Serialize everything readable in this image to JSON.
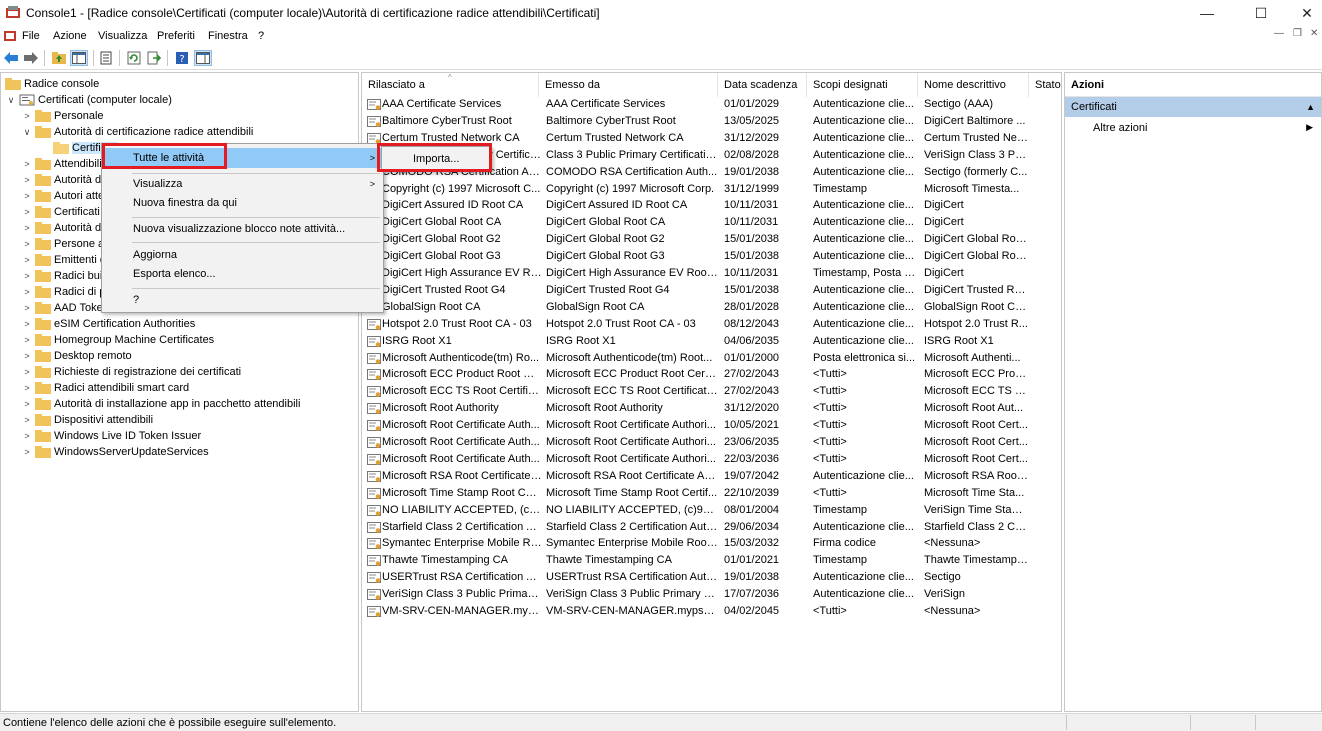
{
  "window": {
    "title": "Console1 - [Radice console\\Certificati (computer locale)\\Autorità di certificazione radice attendibili\\Certificati]",
    "min_glyph": "—",
    "max_glyph": "☐",
    "close_glyph": "✕"
  },
  "menubar": {
    "items": [
      "File",
      "Azione",
      "Visualizza",
      "Preferiti",
      "Finestra",
      "?"
    ],
    "inner_min": "—",
    "inner_restore": "❐",
    "inner_close": "✕"
  },
  "toolbar": {
    "icons": [
      "back-arrow-icon",
      "forward-arrow-icon",
      "up-folder-icon",
      "show-hide-console-tree-icon",
      "properties-icon",
      "refresh-icon",
      "export-list-icon",
      "help-icon",
      "show-hide-action-pane-icon"
    ]
  },
  "tree": {
    "items": [
      {
        "label": "Radice console",
        "level": 0,
        "twisty": ""
      },
      {
        "label": "Certificati (computer locale)",
        "level": 1,
        "twisty": "∨"
      },
      {
        "label": "Personale",
        "level": 2,
        "twisty": ">"
      },
      {
        "label": "Autorità di certificazione radice attendibili",
        "level": 2,
        "twisty": "∨"
      },
      {
        "label": "Certificati",
        "level": 3,
        "twisty": "",
        "selected": true
      },
      {
        "label": "Attendibilità",
        "level": 2,
        "twisty": ">"
      },
      {
        "label": "Autorità di certificazione intermedie",
        "level": 2,
        "twisty": ">"
      },
      {
        "label": "Autori attendibili",
        "level": 2,
        "twisty": ">"
      },
      {
        "label": "Certificati non attendibili",
        "level": 2,
        "twisty": ">"
      },
      {
        "label": "Autorità di certificazione radice di terze parti",
        "level": 2,
        "twisty": ">"
      },
      {
        "label": "Persone attendibili",
        "level": 2,
        "twisty": ">"
      },
      {
        "label": "Emittenti di autenticazione client",
        "level": 2,
        "twisty": ">"
      },
      {
        "label": "Radici build di anteprima",
        "level": 2,
        "twisty": ">"
      },
      {
        "label": "Radici di prova",
        "level": 2,
        "twisty": ">"
      },
      {
        "label": "AAD Token Issuer",
        "level": 2,
        "twisty": ">"
      },
      {
        "label": "eSIM Certification Authorities",
        "level": 2,
        "twisty": ">"
      },
      {
        "label": "Homegroup Machine Certificates",
        "level": 2,
        "twisty": ">"
      },
      {
        "label": "Desktop remoto",
        "level": 2,
        "twisty": ">"
      },
      {
        "label": "Richieste di registrazione dei certificati",
        "level": 2,
        "twisty": ">"
      },
      {
        "label": "Radici attendibili smart card",
        "level": 2,
        "twisty": ">"
      },
      {
        "label": "Autorità di installazione app in pacchetto attendibili",
        "level": 2,
        "twisty": ">"
      },
      {
        "label": "Dispositivi attendibili",
        "level": 2,
        "twisty": ">"
      },
      {
        "label": "Windows Live ID Token Issuer",
        "level": 2,
        "twisty": ">"
      },
      {
        "label": "WindowsServerUpdateServices",
        "level": 2,
        "twisty": ">"
      }
    ]
  },
  "list": {
    "columns": [
      "Rilasciato a",
      "Emesso da",
      "Data scadenza",
      "Scopi designati",
      "Nome descrittivo",
      "Stato"
    ],
    "sort_glyph": "^",
    "rows": [
      [
        "AAA Certificate Services",
        "AAA Certificate Services",
        "01/01/2029",
        "Autenticazione clie...",
        "Sectigo (AAA)"
      ],
      [
        "Baltimore CyberTrust Root",
        "Baltimore CyberTrust Root",
        "13/05/2025",
        "Autenticazione clie...",
        "DigiCert Baltimore ..."
      ],
      [
        "Certum Trusted Network CA",
        "Certum Trusted Network CA",
        "31/12/2029",
        "Autenticazione clie...",
        "Certum Trusted Net..."
      ],
      [
        "Class 3 Public Primary Certification Authority",
        "Class 3 Public Primary Certificatio...",
        "02/08/2028",
        "Autenticazione clie...",
        "VeriSign Class 3 Pu..."
      ],
      [
        "COMODO RSA Certification Authority",
        "COMODO RSA Certification Auth...",
        "19/01/2038",
        "Autenticazione clie...",
        "Sectigo (formerly C..."
      ],
      [
        "Copyright (c) 1997 Microsoft C...",
        "Copyright (c) 1997 Microsoft Corp.",
        "31/12/1999",
        "Timestamp",
        "Microsoft Timesta..."
      ],
      [
        "DigiCert Assured ID Root CA",
        "DigiCert Assured ID Root CA",
        "10/11/2031",
        "Autenticazione clie...",
        "DigiCert"
      ],
      [
        "DigiCert Global Root CA",
        "DigiCert Global Root CA",
        "10/11/2031",
        "Autenticazione clie...",
        "DigiCert"
      ],
      [
        "DigiCert Global Root G2",
        "DigiCert Global Root G2",
        "15/01/2038",
        "Autenticazione clie...",
        "DigiCert Global Roo..."
      ],
      [
        "DigiCert Global Root G3",
        "DigiCert Global Root G3",
        "15/01/2038",
        "Autenticazione clie...",
        "DigiCert Global Roo..."
      ],
      [
        "DigiCert High Assurance EV Ro...",
        "DigiCert High Assurance EV Root ...",
        "10/11/2031",
        "Timestamp, Posta e...",
        "DigiCert"
      ],
      [
        "DigiCert Trusted Root G4",
        "DigiCert Trusted Root G4",
        "15/01/2038",
        "Autenticazione clie...",
        "DigiCert Trusted Ro..."
      ],
      [
        "GlobalSign Root CA",
        "GlobalSign Root CA",
        "28/01/2028",
        "Autenticazione clie...",
        "GlobalSign Root CA..."
      ],
      [
        "Hotspot 2.0 Trust Root CA - 03",
        "Hotspot 2.0 Trust Root CA - 03",
        "08/12/2043",
        "Autenticazione clie...",
        "Hotspot 2.0 Trust R..."
      ],
      [
        "ISRG Root X1",
        "ISRG Root X1",
        "04/06/2035",
        "Autenticazione clie...",
        "ISRG Root X1"
      ],
      [
        "Microsoft Authenticode(tm) Ro...",
        "Microsoft Authenticode(tm) Root...",
        "01/01/2000",
        "Posta elettronica si...",
        "Microsoft Authenti..."
      ],
      [
        "Microsoft ECC Product Root Ce...",
        "Microsoft ECC Product Root Certi...",
        "27/02/2043",
        "<Tutti>",
        "Microsoft ECC Prod..."
      ],
      [
        "Microsoft ECC TS Root Certifica...",
        "Microsoft ECC TS Root Certificate ...",
        "27/02/2043",
        "<Tutti>",
        "Microsoft ECC TS R..."
      ],
      [
        "Microsoft Root Authority",
        "Microsoft Root Authority",
        "31/12/2020",
        "<Tutti>",
        "Microsoft Root Aut..."
      ],
      [
        "Microsoft Root Certificate Auth...",
        "Microsoft Root Certificate Authori...",
        "10/05/2021",
        "<Tutti>",
        "Microsoft Root Cert..."
      ],
      [
        "Microsoft Root Certificate Auth...",
        "Microsoft Root Certificate Authori...",
        "23/06/2035",
        "<Tutti>",
        "Microsoft Root Cert..."
      ],
      [
        "Microsoft Root Certificate Auth...",
        "Microsoft Root Certificate Authori...",
        "22/03/2036",
        "<Tutti>",
        "Microsoft Root Cert..."
      ],
      [
        "Microsoft RSA Root Certificate ...",
        "Microsoft RSA Root Certificate Au...",
        "19/07/2042",
        "Autenticazione clie...",
        "Microsoft RSA Root..."
      ],
      [
        "Microsoft Time Stamp Root Cer...",
        "Microsoft Time Stamp Root Certif...",
        "22/10/2039",
        "<Tutti>",
        "Microsoft Time Sta..."
      ],
      [
        "NO LIABILITY ACCEPTED, (c)97 ...",
        "NO LIABILITY ACCEPTED, (c)97 Ve...",
        "08/01/2004",
        "Timestamp",
        "VeriSign Time Stam..."
      ],
      [
        "Starfield Class 2 Certification A...",
        "Starfield Class 2 Certification Auth...",
        "29/06/2034",
        "Autenticazione clie...",
        "Starfield Class 2 Cer..."
      ],
      [
        "Symantec Enterprise Mobile Ro...",
        "Symantec Enterprise Mobile Root ...",
        "15/03/2032",
        "Firma codice",
        "<Nessuna>"
      ],
      [
        "Thawte Timestamping CA",
        "Thawte Timestamping CA",
        "01/01/2021",
        "Timestamp",
        "Thawte Timestampi..."
      ],
      [
        "USERTrust RSA Certification Aut...",
        "USERTrust RSA Certification Autho...",
        "19/01/2038",
        "Autenticazione clie...",
        "Sectigo"
      ],
      [
        "VeriSign Class 3 Public Primary ...",
        "VeriSign Class 3 Public Primary C...",
        "17/07/2036",
        "Autenticazione clie...",
        "VeriSign"
      ],
      [
        "VM-SRV-CEN-MANAGER.myps...",
        "VM-SRV-CEN-MANAGER.mypsx....",
        "04/02/2045",
        "<Tutti>",
        "<Nessuna>"
      ]
    ]
  },
  "actions": {
    "header": "Azioni",
    "section": "Certificati",
    "section_glyph": "▲",
    "item": "Altre azioni",
    "item_glyph": "▶"
  },
  "context_menu": {
    "items": [
      {
        "label": "Tutte le attività",
        "submenu": true
      },
      {
        "label": "Visualizza",
        "submenu": true
      },
      {
        "label": "Nuova finestra da qui",
        "submenu": false
      },
      {
        "label": "Nuova visualizzazione blocco note attività...",
        "submenu": false
      },
      {
        "label": "Aggiorna",
        "submenu": false
      },
      {
        "label": "Esporta elenco...",
        "submenu": false
      },
      {
        "label": "?",
        "submenu": false
      }
    ],
    "arrow_glyph": ">",
    "submenu_item": "Importa..."
  },
  "status": {
    "text": "Contiene l'elenco delle azioni che è possibile eseguire sull'elemento."
  },
  "colors": {
    "highlight": "#91c9f7",
    "callout": "#e31b23",
    "section": "#b3cde9"
  }
}
